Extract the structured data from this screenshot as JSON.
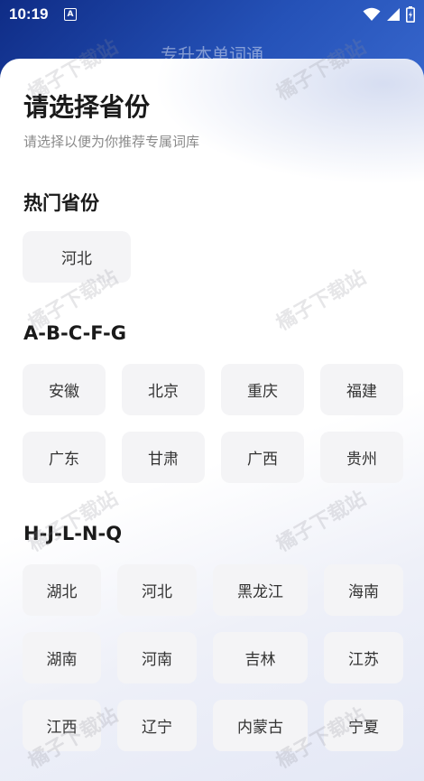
{
  "status": {
    "time": "10:19",
    "notif": "A"
  },
  "app_title": "专升本单词通",
  "sheet": {
    "title": "请选择省份",
    "subtitle": "请选择以便为你推荐专属词库"
  },
  "sections": {
    "hot": "热门省份",
    "g1": "A-B-C-F-G",
    "g2": "H-J-L-N-Q"
  },
  "hot_provinces": [
    "河北"
  ],
  "group1": [
    "安徽",
    "北京",
    "重庆",
    "福建",
    "广东",
    "甘肃",
    "广西",
    "贵州"
  ],
  "group2": [
    "湖北",
    "河北",
    "黑龙江",
    "海南",
    "湖南",
    "河南",
    "吉林",
    "江苏",
    "江西",
    "辽宁",
    "内蒙古",
    "宁夏"
  ],
  "watermark": "橘子下载站"
}
